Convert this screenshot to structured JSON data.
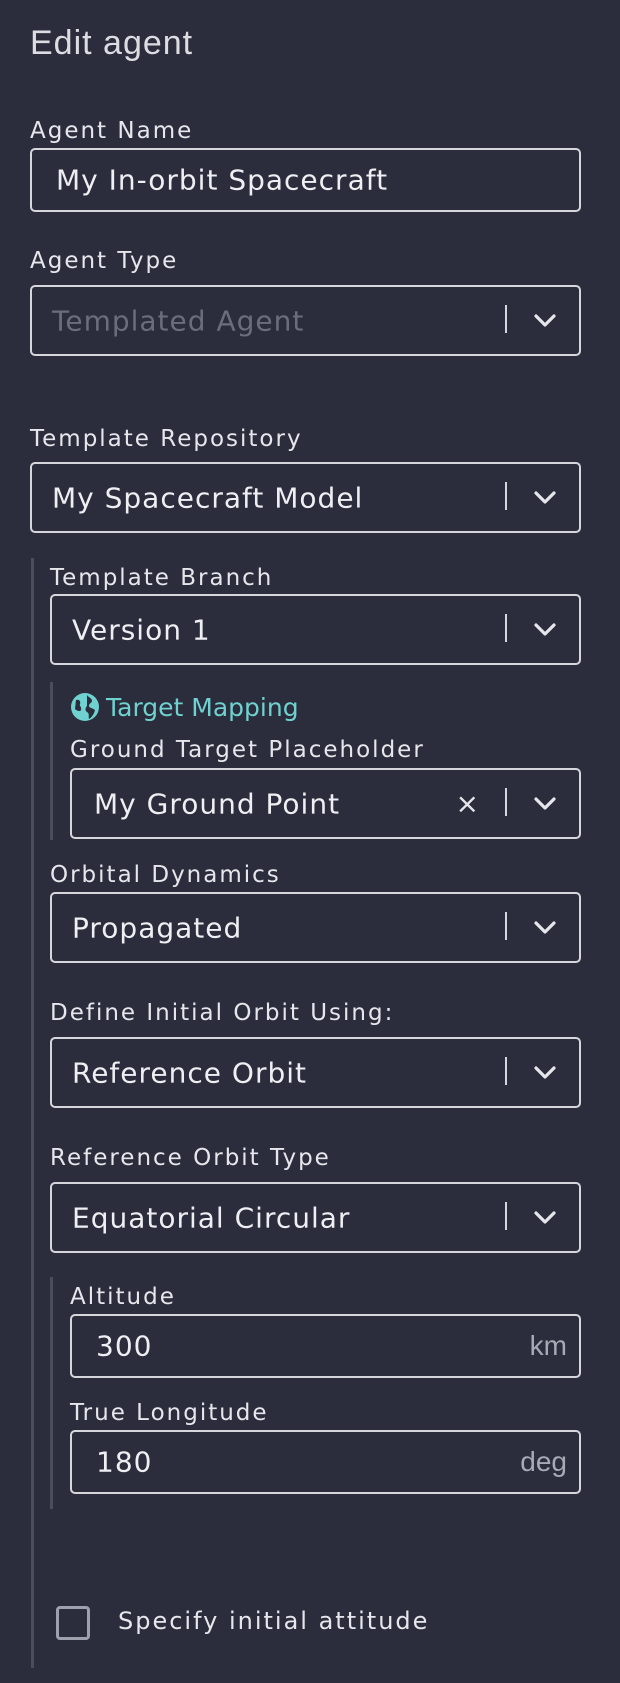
{
  "form": {
    "title": "Edit agent",
    "agent_name": {
      "label": "Agent Name",
      "value": "My In-orbit Spacecraft"
    },
    "agent_type": {
      "label": "Agent Type",
      "placeholder": "Templated Agent"
    },
    "template_repository": {
      "label": "Template Repository",
      "value": "My Spacecraft Model"
    },
    "template_branch": {
      "label": "Template Branch",
      "value": "Version 1"
    },
    "target_mapping": {
      "title": "Target Mapping",
      "icon": "globe-icon",
      "color": "#6fd2d0",
      "ground_target": {
        "label": "Ground Target Placeholder",
        "value": "My Ground Point",
        "clear_icon": "×"
      }
    },
    "orbital_dynamics": {
      "label": "Orbital Dynamics",
      "value": "Propagated"
    },
    "initial_orbit": {
      "label": "Define Initial Orbit Using:",
      "value": "Reference Orbit"
    },
    "reference_orbit_type": {
      "label": "Reference Orbit Type",
      "value": "Equatorial Circular"
    },
    "altitude": {
      "label": "Altitude",
      "value": "300",
      "unit": "km"
    },
    "true_longitude": {
      "label": "True Longitude",
      "value": "180",
      "unit": "deg"
    },
    "initial_attitude": {
      "label": "Specify initial attitude",
      "checked": false
    }
  }
}
